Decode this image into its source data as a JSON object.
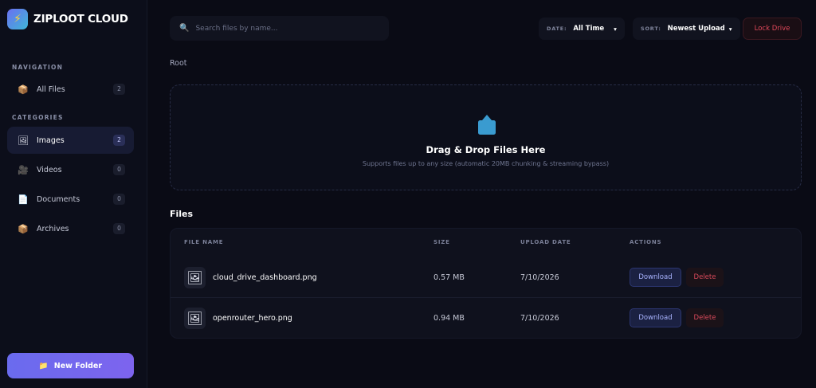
{
  "brand": {
    "name": "ZIPLOOT CLOUD",
    "logo_icon": "lightning-bolt-icon"
  },
  "sidebar": {
    "navigation_label": "NAVIGATION",
    "categories_label": "CATEGORIES",
    "nav_items": [
      {
        "label": "All Files",
        "count": "2",
        "icon": "box-icon"
      }
    ],
    "category_items": [
      {
        "label": "Images",
        "count": "2",
        "icon": "image-icon",
        "active": true
      },
      {
        "label": "Videos",
        "count": "0",
        "icon": "camera-icon"
      },
      {
        "label": "Documents",
        "count": "0",
        "icon": "document-icon"
      },
      {
        "label": "Archives",
        "count": "0",
        "icon": "box-icon"
      }
    ],
    "new_folder_label": "New Folder"
  },
  "search": {
    "placeholder": "Search files by name..."
  },
  "filters": {
    "date_label": "DATE:",
    "date_value": "All Time",
    "sort_label": "SORT:",
    "sort_value": "Newest Upload"
  },
  "lock_label": "Lock Drive",
  "breadcrumb": "Root",
  "dropzone": {
    "title": "Drag & Drop Files Here",
    "subtitle": "Supports files up to any size (automatic 20MB chunking & streaming bypass)"
  },
  "files": {
    "title": "Files",
    "columns": [
      "FILE NAME",
      "SIZE",
      "UPLOAD DATE",
      "ACTIONS"
    ],
    "rows": [
      {
        "name": "cloud_drive_dashboard.png",
        "size": "0.57 MB",
        "date": "7/10/2026"
      },
      {
        "name": "openrouter_hero.png",
        "size": "0.94 MB",
        "date": "7/10/2026"
      }
    ],
    "download_label": "Download",
    "delete_label": "Delete"
  },
  "colors": {
    "background": "#0a0b15",
    "accent": "#6a6bee",
    "danger": "#e0485a",
    "upload_icon": "#3a9bd0"
  }
}
